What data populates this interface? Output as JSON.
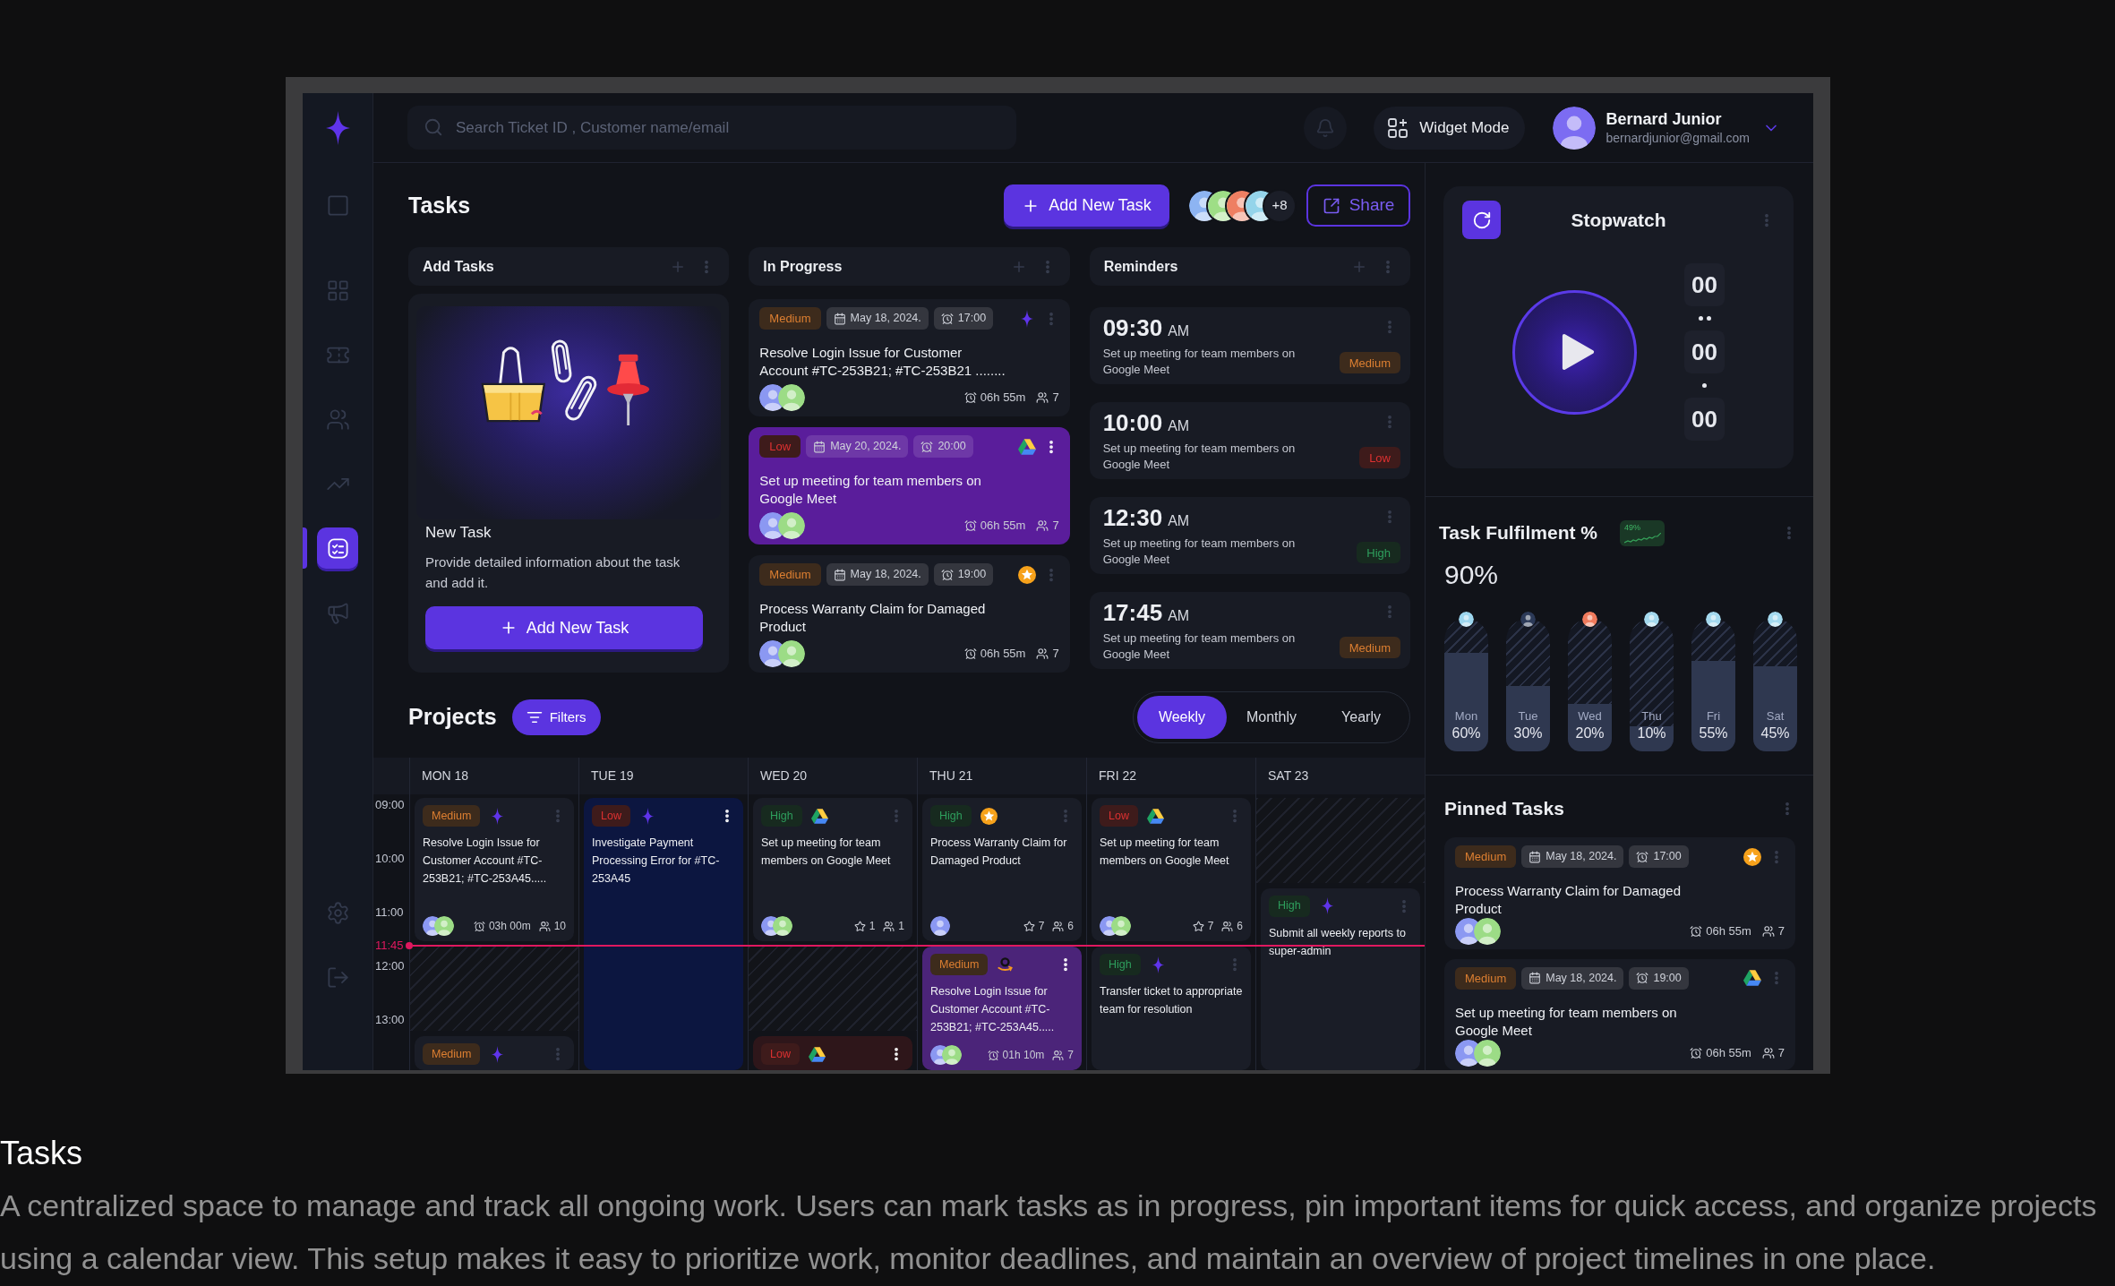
{
  "sidebar": {
    "nav_items": [
      {
        "selected": false
      },
      {
        "selected": false
      },
      {
        "selected": false
      },
      {
        "selected": false
      },
      {
        "selected": false
      },
      {
        "selected": true
      },
      {
        "selected": false
      }
    ]
  },
  "header": {
    "search": {
      "placeholder": "Search Ticket ID , Customer name/email"
    },
    "widget_button": "Widget Mode",
    "user": {
      "name": "Bernard Junior",
      "email": "bernardjunior@gmail.com"
    }
  },
  "tasks": {
    "title": "Tasks",
    "add_button": "Add New Task",
    "members": [
      {
        "color": "#8db4f2"
      },
      {
        "color": "#9ede86"
      },
      {
        "color": "#ee7f62"
      },
      {
        "color": "#94d4ea"
      }
    ],
    "more_members": "+8",
    "share_button": "Share",
    "add_tasks": {
      "title": "Add Tasks",
      "card_title": "New Task",
      "description": "Provide detailed information about the task and add it.",
      "button": "Add New Task"
    },
    "in_progress": {
      "title": "In Progress",
      "cards": [
        {
          "selected": false,
          "priority": {
            "label": "Medium",
            "color": "#3d2b1c"
          },
          "date": "May 18, 2024.",
          "time": "17:00",
          "kind": "sparkle",
          "title": "Resolve Login Issue for Customer Account #TC-253B21; #TC-253B21 ........",
          "avatars": [
            {
              "color": "#8b98f2"
            },
            {
              "color": "#9cdc86"
            }
          ],
          "duration": "06h 55m",
          "members": "7"
        },
        {
          "selected": true,
          "priority": {
            "label": "Low",
            "color": "#3e1b1b"
          },
          "date": "May 20, 2024.",
          "time": "20:00",
          "kind": "triangle",
          "title": "Set up meeting for team members on Google Meet",
          "avatars": [
            {
              "color": "#8b98f2"
            },
            {
              "color": "#9cdc86"
            }
          ],
          "duration": "06h 55m",
          "members": "7"
        },
        {
          "selected": false,
          "priority": {
            "label": "Medium",
            "color": "#3d2b1c"
          },
          "date": "May 18, 2024.",
          "time": "19:00",
          "kind": "star",
          "title": "Process Warranty Claim for Damaged Product",
          "avatars": [
            {
              "color": "#8b98f2"
            },
            {
              "color": "#9cdc86"
            }
          ],
          "duration": "06h 55m",
          "members": "7"
        }
      ]
    },
    "reminders": {
      "title": "Reminders",
      "items": [
        {
          "time": "09:30",
          "meridiem": "AM",
          "text": "Set up meeting for team members on Google Meet",
          "priority": {
            "label": "Medium",
            "color": "#3d2b1c"
          }
        },
        {
          "time": "10:00",
          "meridiem": "AM",
          "text": "Set up meeting for team members on Google Meet",
          "priority": {
            "label": "Low",
            "color": "#3e1b1b"
          }
        },
        {
          "time": "12:30",
          "meridiem": "AM",
          "text": "Set up meeting for team members on Google Meet",
          "priority": {
            "label": "High",
            "color": "#172a1f"
          }
        },
        {
          "time": "17:45",
          "meridiem": "AM",
          "text": "Set up meeting for team members on Google Meet",
          "priority": {
            "label": "Medium",
            "color": "#3d2b1c"
          }
        }
      ]
    }
  },
  "projects": {
    "title": "Projects",
    "filters_button": "Filters",
    "periods": [
      {
        "label": "Weekly",
        "selected": true
      },
      {
        "label": "Monthly",
        "selected": false
      },
      {
        "label": "Yearly",
        "selected": false
      }
    ],
    "calendar": {
      "hours": [
        "09:00",
        "10:00",
        "11:00",
        "12:00",
        "13:00"
      ],
      "now": "11:45",
      "days": [
        {
          "label": "MON 18",
          "slots": [
            {
              "kind": "sparkle",
              "color": "#1a1d27",
              "priority": {
                "label": "Medium",
                "color": "#3d2b1c"
              },
              "title": "Resolve Login Issue for Customer Account #TC-253B21; #TC-253A45.....",
              "avatars": [
                {
                  "color": "#8b98f2"
                },
                {
                  "color": "#9cdc86"
                }
              ],
              "duration": "03h 00m",
              "members": "10"
            },
            {
              "kind": "blocked"
            },
            {
              "kind": "sparkle",
              "color": "#1a1d27",
              "priority": {
                "label": "Medium",
                "color": "#3d2b1c"
              }
            }
          ]
        },
        {
          "label": "TUE 19",
          "slots": [
            {
              "kind": "sparkle",
              "color": "#0c1640",
              "priority": {
                "label": "Low",
                "color": "#3e1b1b"
              },
              "title": "Investigate Payment Processing Error for #TC-253A45"
            }
          ]
        },
        {
          "label": "WED 20",
          "slots": [
            {
              "kind": "triangle",
              "color": "#1a1d27",
              "priority": {
                "label": "High",
                "color": "#172a1f"
              },
              "title": "Set up meeting for team members on Google Meet",
              "avatars": [
                {
                  "color": "#8b98f2"
                },
                {
                  "color": "#9cdc86"
                }
              ],
              "rating": "1",
              "members": "1"
            },
            {
              "kind": "blocked"
            },
            {
              "kind": "triangle",
              "color": "#2e161a",
              "priority": {
                "label": "Low",
                "color": "#3e1b1b"
              }
            }
          ]
        },
        {
          "label": "THU 21",
          "slots": [
            {
              "kind": "star",
              "color": "#1a1d27",
              "priority": {
                "label": "High",
                "color": "#172a1f"
              },
              "title": "Process Warranty Claim for Damaged Product",
              "avatars": [
                {
                  "color": "#8b98f2"
                }
              ],
              "rating": "7",
              "members": "6"
            },
            {
              "kind": "smile",
              "color": "#4b2479",
              "priority": {
                "label": "Medium",
                "color": "#3d2b1c"
              },
              "title": "Resolve Login Issue for Customer Account #TC-253B21; #TC-253A45.....",
              "avatars": [
                {
                  "color": "#8b98f2"
                },
                {
                  "color": "#9cdc86"
                }
              ],
              "duration": "01h 10m",
              "members": "7"
            }
          ]
        },
        {
          "label": "FRI 22",
          "slots": [
            {
              "kind": "triangle",
              "color": "#1a1d27",
              "priority": {
                "label": "Low",
                "color": "#3e1b1b"
              },
              "title": "Set up meeting for team members on Google Meet",
              "avatars": [
                {
                  "color": "#8b98f2"
                },
                {
                  "color": "#9cdc86"
                }
              ],
              "rating": "7",
              "members": "6"
            },
            {
              "kind": "sparkle",
              "color": "#1a1d27",
              "priority": {
                "label": "High",
                "color": "#172a1f"
              },
              "title": "Transfer ticket to appropriate team for resolution"
            }
          ]
        },
        {
          "label": "SAT 23",
          "slots": [
            {
              "kind": "blocked"
            },
            {
              "kind": "sparkle",
              "color": "#1a1d27",
              "priority": {
                "label": "High",
                "color": "#172a1f"
              },
              "title": "Submit all weekly reports to super-admin"
            }
          ]
        }
      ]
    }
  },
  "stopwatch": {
    "title": "Stopwatch",
    "digits": [
      "00",
      "00",
      "00"
    ]
  },
  "fulfilment": {
    "title": "Task Fulfilment %",
    "trend": "49%",
    "total": "90%",
    "days": [
      {
        "label": "Mon",
        "value": "60%",
        "level": 0.74,
        "avatar": {
          "color": "#9dd6ee"
        }
      },
      {
        "label": "Tue",
        "value": "30%",
        "level": 0.49,
        "avatar": {
          "color": "#2c3a58"
        }
      },
      {
        "label": "Wed",
        "value": "20%",
        "level": 0.36,
        "avatar": {
          "color": "#ef7a5c"
        }
      },
      {
        "label": "Thu",
        "value": "10%",
        "level": 0.19,
        "avatar": {
          "color": "#a4d9ee"
        }
      },
      {
        "label": "Fri",
        "value": "55%",
        "level": 0.68,
        "avatar": {
          "color": "#a4d9ee"
        }
      },
      {
        "label": "Sat",
        "value": "45%",
        "level": 0.64,
        "avatar": {
          "color": "#a4d9ee"
        }
      }
    ]
  },
  "pinned": {
    "title": "Pinned Tasks",
    "cards": [
      {
        "selected": false,
        "priority": {
          "label": "Medium",
          "color": "#3d2b1c"
        },
        "date": "May 18, 2024.",
        "time": "17:00",
        "kind": "star",
        "title": "Process Warranty Claim for Damaged Product",
        "avatars": [
          {
            "color": "#8b98f2"
          },
          {
            "color": "#9cdc86"
          }
        ],
        "duration": "06h 55m",
        "members": "7"
      },
      {
        "selected": false,
        "priority": {
          "label": "Medium",
          "color": "#3d2b1c"
        },
        "date": "May 18, 2024.",
        "time": "19:00",
        "kind": "triangle",
        "title": "Set up meeting for team members on Google Meet",
        "avatars": [
          {
            "color": "#8b98f2"
          },
          {
            "color": "#9cdc86"
          }
        ],
        "duration": "06h 55m",
        "members": "7"
      }
    ]
  },
  "caption": {
    "title": "Tasks",
    "text": "A centralized space to manage and track all ongoing work. Users can mark tasks as in progress, pin important items for quick access, and organize projects using a calendar view. This setup makes it easy to prioritize work, monitor deadlines, and maintain an overview of project timelines in one place."
  }
}
